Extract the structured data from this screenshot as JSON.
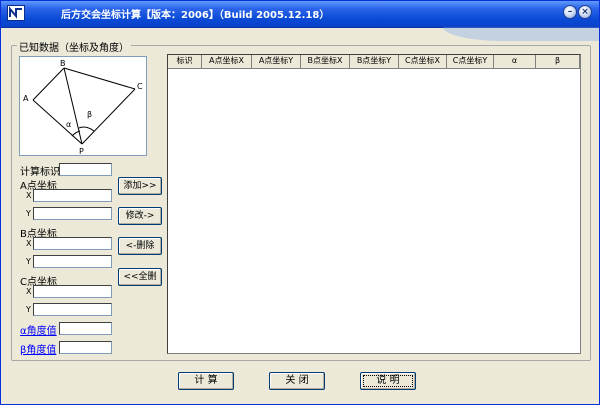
{
  "window": {
    "title": "后方交会坐标计算【版本：2006】（Build 2005.12.18）",
    "minimize_glyph": "–",
    "close_glyph": "×",
    "colors": {
      "titlebar": "#0a4ad6",
      "face": "#ece9d8",
      "link": "#0000ff"
    }
  },
  "group": {
    "title": "已知数据（坐标及角度）"
  },
  "diagram": {
    "points": {
      "A": "A",
      "B": "B",
      "C": "C",
      "P": "P"
    },
    "angles": {
      "alpha": "α",
      "beta": "β"
    }
  },
  "form": {
    "calc_id_label": "计算标识",
    "calc_id_value": "",
    "a_coord_label": "A点坐标",
    "b_coord_label": "B点坐标",
    "c_coord_label": "C点坐标",
    "x_label": "X",
    "y_label": "Y",
    "ax_value": "",
    "ay_value": "",
    "bx_value": "",
    "by_value": "",
    "cx_value": "",
    "cy_value": "",
    "alpha_label": "α角度值",
    "beta_label": "β角度值",
    "alpha_value": "",
    "beta_value": ""
  },
  "side_buttons": {
    "add": "添加>>",
    "modify": "修改->",
    "delete": "<-删除",
    "delete_all": "<<全删"
  },
  "table": {
    "columns": [
      "标识",
      "A点坐标X",
      "A点坐标Y",
      "B点坐标X",
      "B点坐标Y",
      "C点坐标X",
      "C点坐标Y",
      "α",
      "β"
    ],
    "rows": []
  },
  "bottom_buttons": {
    "calculate": "计 算",
    "close": "关 闭",
    "help": "说 明"
  },
  "icons": [
    "app-icon",
    "minimize-icon",
    "close-icon"
  ]
}
